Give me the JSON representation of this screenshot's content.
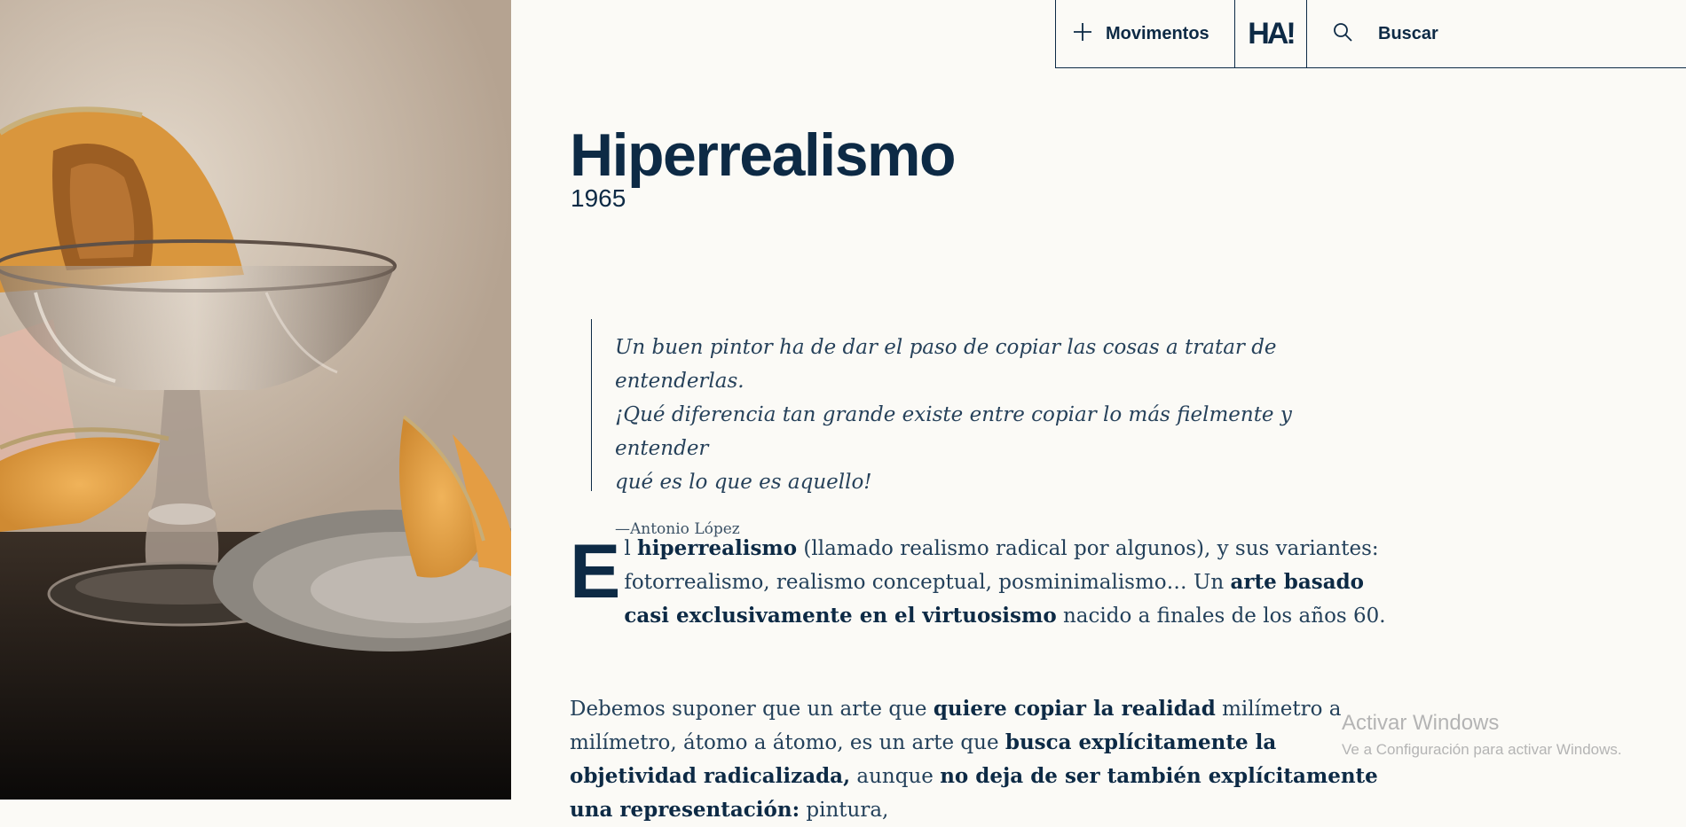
{
  "nav": {
    "movimentos_label": "Movimentos",
    "logo_text": "HA!",
    "search_label": "Buscar"
  },
  "article": {
    "title": "Hiperrealismo",
    "year": "1965"
  },
  "quote": {
    "lines": [
      "Un buen pintor ha de dar el paso de copiar las cosas a tratar de entenderlas.",
      "¡Qué diferencia tan grande existe entre copiar lo más fielmente y entender",
      "qué es lo que es aquello!"
    ],
    "author": "—Antonio López"
  },
  "paragraph1": {
    "dropcap": "E",
    "t1": "l ",
    "b1": "hiperrealismo",
    "t2": " (llamado realismo radical por algunos), y sus variantes: fotorrealismo, realismo conceptual, posminimalismo… Un ",
    "b2": "arte basado casi exclusivamente en el virtuosismo",
    "t3": " nacido a finales de los años 60."
  },
  "paragraph2": {
    "t1": "Debemos suponer que un arte que ",
    "b1": "quiere copiar la realidad",
    "t2": " milímetro a milímetro, átomo a átomo, es un arte que ",
    "b2": "busca explícitamente la objetividad radicalizada,",
    "t3": " aunque ",
    "b3": "no deja de ser también explícitamente una representación:",
    "t4": " pintura,"
  },
  "watermark": {
    "title": "Activar Windows",
    "subtitle": "Ve a Configuración para activar Windows."
  },
  "colors": {
    "background": "#fbfaf6",
    "navy": "#0d2a45",
    "melon": "#e3a04c"
  }
}
